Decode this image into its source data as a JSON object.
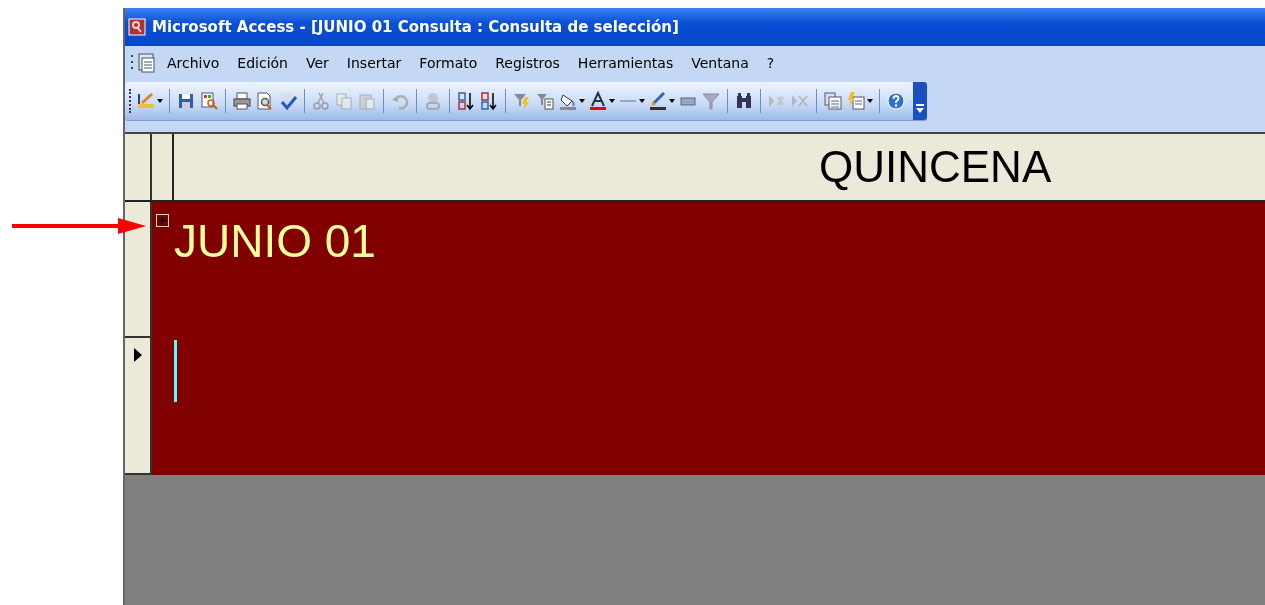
{
  "window": {
    "title": "Microsoft Access - [JUNIO 01 Consulta : Consulta de selección]"
  },
  "menu": [
    "Archivo",
    "Edición",
    "Ver",
    "Insertar",
    "Formato",
    "Registros",
    "Herramientas",
    "Ventana",
    "?"
  ],
  "datasheet": {
    "columns": [
      "QUINCENA"
    ],
    "rows": [
      {
        "quincena": "JUNIO 01",
        "expandable": true,
        "current": false
      },
      {
        "current": true
      }
    ]
  }
}
